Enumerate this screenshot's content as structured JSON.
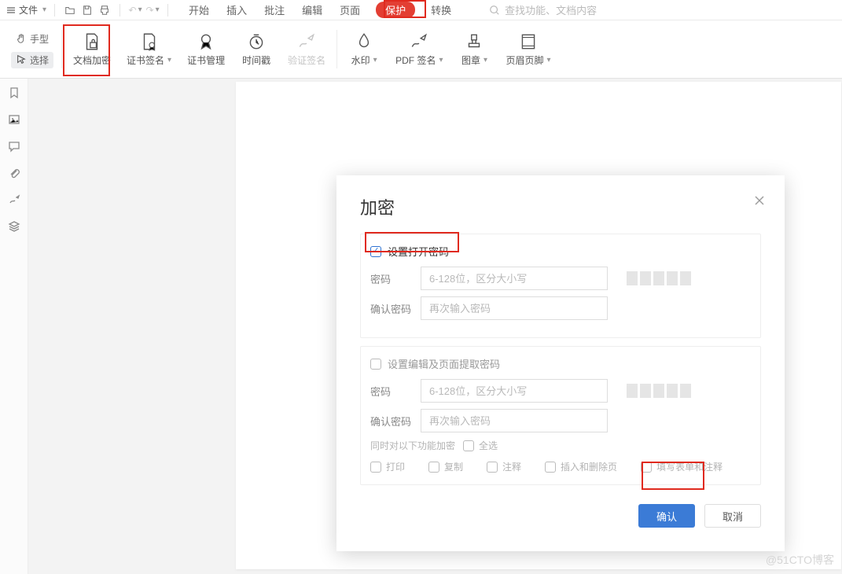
{
  "top": {
    "file_label": "文件",
    "menu": {
      "start": "开始",
      "insert": "插入",
      "annotate": "批注",
      "edit": "编辑",
      "page": "页面",
      "protect": "保护",
      "convert": "转换"
    },
    "search_placeholder": "查找功能、文档内容"
  },
  "modes": {
    "hand": "手型",
    "select": "选择"
  },
  "ribbon": {
    "encrypt": "文档加密",
    "cert_sign": "证书签名",
    "cert_manage": "证书管理",
    "timestamp": "时间戳",
    "verify_sign": "验证签名",
    "watermark": "水印",
    "pdf_sign": "PDF 签名",
    "stamp": "图章",
    "header_footer": "页眉页脚"
  },
  "dialog": {
    "title": "加密",
    "open_pw_label": "设置打开密码",
    "pw_label": "密码",
    "pw_placeholder": "6-128位，区分大小写",
    "confirm_label": "确认密码",
    "confirm_placeholder": "再次输入密码",
    "edit_pw_label": "设置编辑及页面提取密码",
    "sub_label": "同时对以下功能加密",
    "select_all": "全选",
    "opts": {
      "print": "打印",
      "copy": "复制",
      "comment": "注释",
      "insert_del": "插入和删除页",
      "form": "填写表单和注释"
    },
    "ok": "确认",
    "cancel": "取消"
  },
  "watermark": "@51CTO博客"
}
